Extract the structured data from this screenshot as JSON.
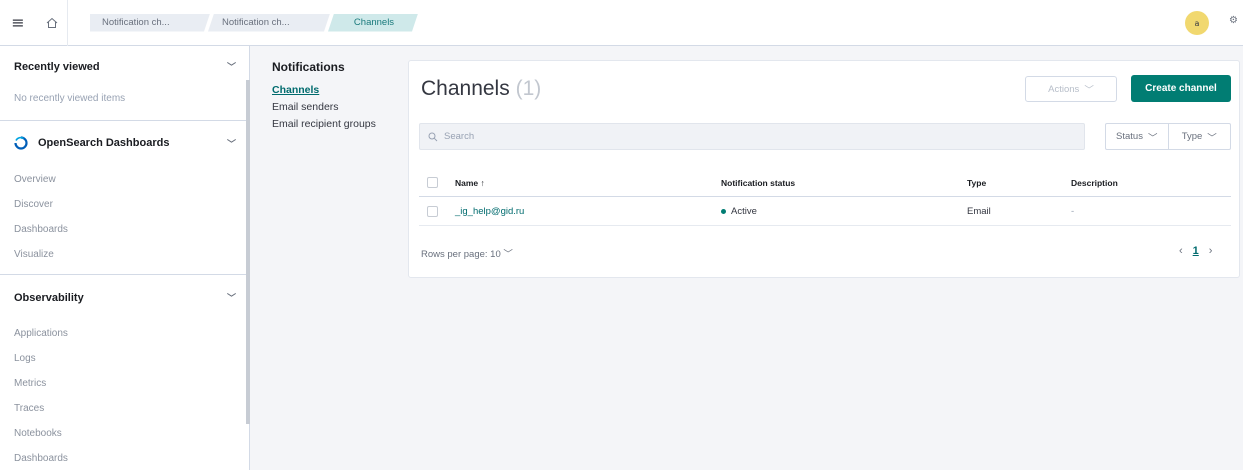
{
  "header": {
    "breadcrumbs": [
      "Notification ch...",
      "Notification ch...",
      "Channels"
    ],
    "avatar_initial": "a",
    "help_glyph": "⚙"
  },
  "leftnav": {
    "recently_viewed": {
      "title": "Recently viewed",
      "empty_text": "No recently viewed items"
    },
    "osd": {
      "title": "OpenSearch Dashboards",
      "items": [
        "Overview",
        "Discover",
        "Dashboards",
        "Visualize"
      ]
    },
    "observability": {
      "title": "Observability",
      "items": [
        "Applications",
        "Logs",
        "Metrics",
        "Traces",
        "Notebooks",
        "Dashboards"
      ]
    }
  },
  "subnav": {
    "title": "Notifications",
    "items": [
      "Channels",
      "Email senders",
      "Email recipient groups"
    ],
    "active": "Channels"
  },
  "main": {
    "title": "Channels",
    "count": "(1)",
    "actions_label": "Actions",
    "create_label": "Create channel",
    "search_placeholder": "Search",
    "filters": [
      "Status",
      "Type"
    ],
    "columns": [
      "Name ↑",
      "Notification status",
      "Type",
      "Description"
    ],
    "rows": [
      {
        "name": "_ig_help@gid.ru",
        "status": "Active",
        "type": "Email",
        "description": "-"
      }
    ],
    "rows_per_page": "Rows per page: 10",
    "current_page": "1"
  },
  "colors": {
    "accent": "#017d73",
    "link": "#006b6e",
    "avatar": "#f1d86f"
  },
  "icons": [
    "menu-icon",
    "home-icon",
    "chevron-down-icon",
    "opensearch-logo-icon",
    "search-icon",
    "sort-asc-icon",
    "chevron-left-icon",
    "chevron-right-icon"
  ]
}
